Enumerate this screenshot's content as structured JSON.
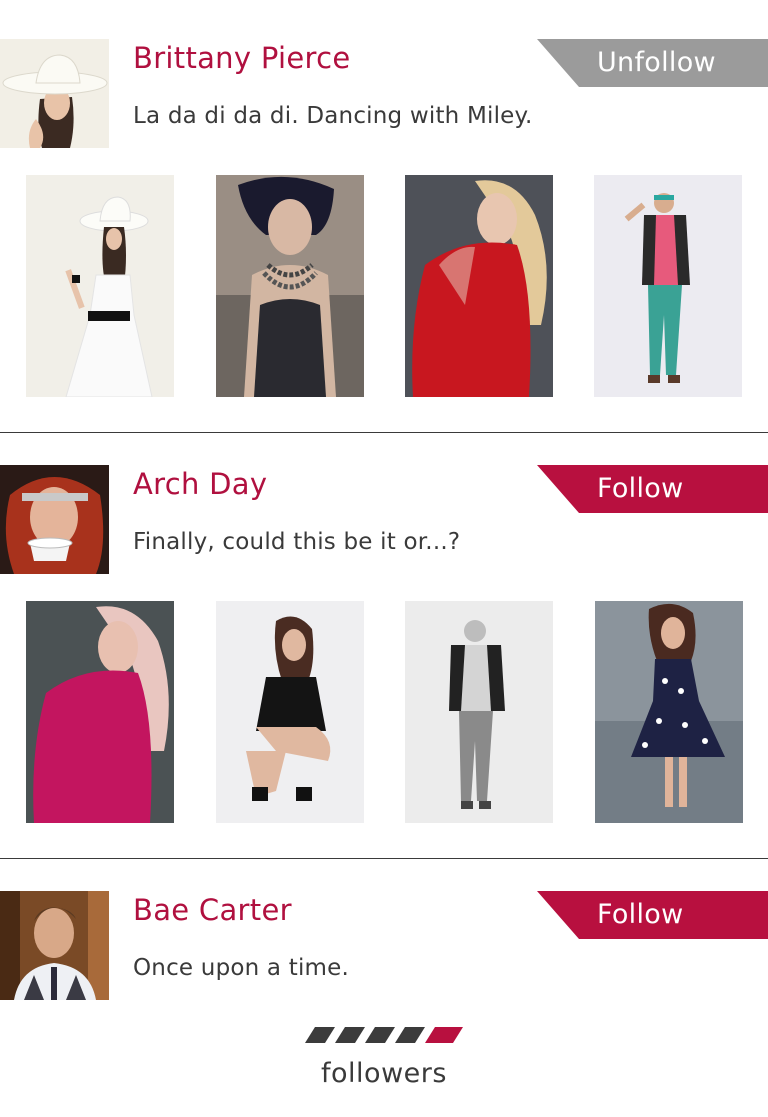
{
  "users": [
    {
      "name": "Brittany Pierce",
      "status": "La da di da di. Dancing with Miley.",
      "button": "Unfollow",
      "button_state": "unfollow",
      "avatar": "woman-white-hat"
    },
    {
      "name": "Arch Day",
      "status": "Finally, could this be it or...?",
      "button": "Follow",
      "button_state": "follow",
      "avatar": "woman-red-hair-teacup"
    },
    {
      "name": "Bae Carter",
      "status": "Once upon a time.",
      "button": "Follow",
      "button_state": "follow",
      "avatar": "man-portrait"
    }
  ],
  "footer": {
    "label": "followers",
    "logo": "striped-followers-logo"
  },
  "colors": {
    "accent": "#b8103f",
    "unfollow": "#9b9b9b",
    "text": "#3a3a3a"
  }
}
